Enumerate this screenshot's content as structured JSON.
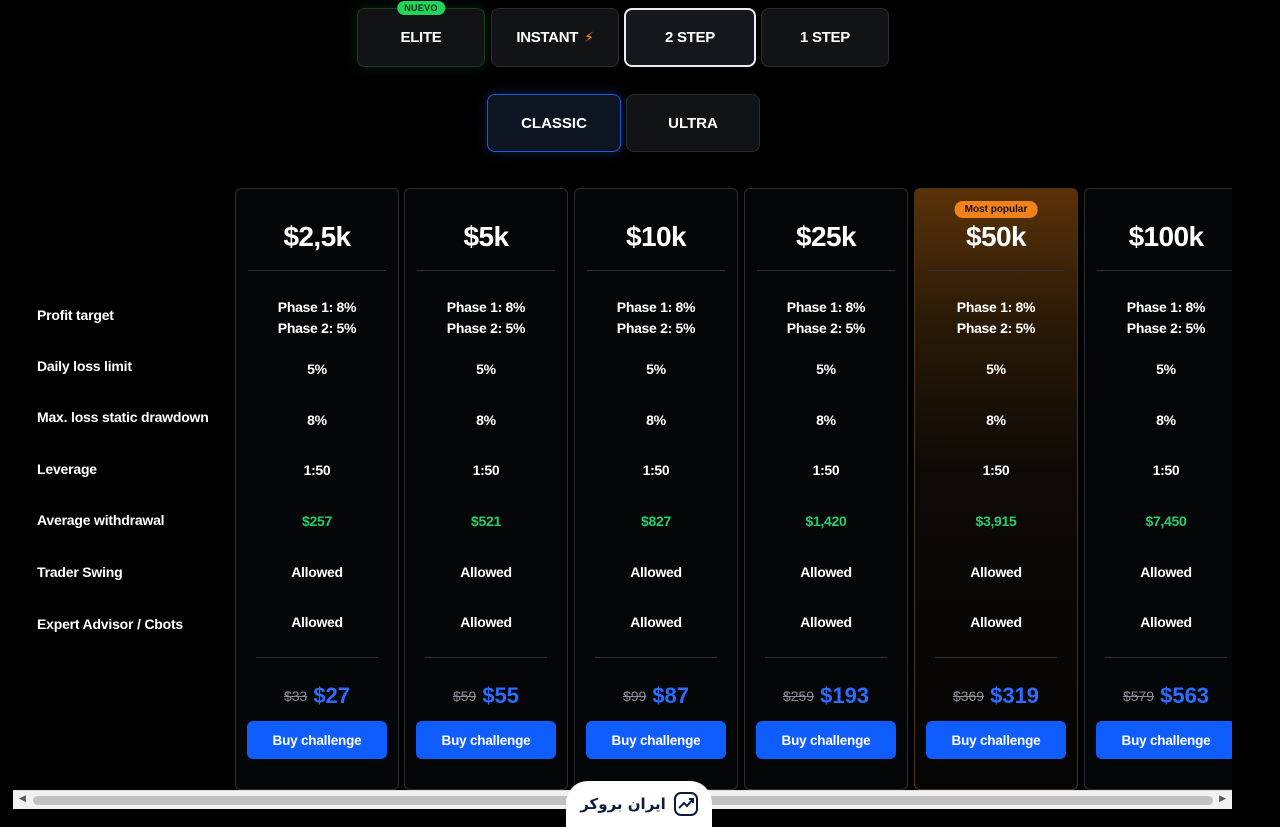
{
  "program_tabs": [
    {
      "label": "ELITE",
      "badge": "NUEVO"
    },
    {
      "label": "INSTANT",
      "icon": "lightning-bolt-icon"
    },
    {
      "label": "2 STEP",
      "active": true
    },
    {
      "label": "1 STEP"
    }
  ],
  "sub_tabs": [
    {
      "label": "CLASSIC",
      "active": true
    },
    {
      "label": "ULTRA"
    }
  ],
  "row_labels": {
    "profit_target": "Profit target",
    "daily_loss": "Daily loss limit",
    "max_loss": "Max.  loss static drawdown",
    "leverage": "Leverage",
    "avg_withdrawal": "Average withdrawal",
    "trader_swing": "Trader Swing",
    "expert_advisor": "Expert Advisor / Cbots"
  },
  "popular_badge": "Most popular",
  "buy_label": "Buy challenge",
  "plans": [
    {
      "size": "$2,5k",
      "phase1": "Phase 1: 8%",
      "phase2": "Phase 2: 5%",
      "daily_loss": "5%",
      "max_loss": "8%",
      "leverage": "1:50",
      "avg_withdrawal": "$257",
      "trader_swing": "Allowed",
      "expert_advisor": "Allowed",
      "old_price": "$33",
      "price": "$27"
    },
    {
      "size": "$5k",
      "phase1": "Phase 1: 8%",
      "phase2": "Phase 2: 5%",
      "daily_loss": "5%",
      "max_loss": "8%",
      "leverage": "1:50",
      "avg_withdrawal": "$521",
      "trader_swing": "Allowed",
      "expert_advisor": "Allowed",
      "old_price": "$59",
      "price": "$55"
    },
    {
      "size": "$10k",
      "phase1": "Phase 1: 8%",
      "phase2": "Phase 2: 5%",
      "daily_loss": "5%",
      "max_loss": "8%",
      "leverage": "1:50",
      "avg_withdrawal": "$827",
      "trader_swing": "Allowed",
      "expert_advisor": "Allowed",
      "old_price": "$99",
      "price": "$87"
    },
    {
      "size": "$25k",
      "phase1": "Phase 1: 8%",
      "phase2": "Phase 2: 5%",
      "daily_loss": "5%",
      "max_loss": "8%",
      "leverage": "1:50",
      "avg_withdrawal": "$1,420",
      "trader_swing": "Allowed",
      "expert_advisor": "Allowed",
      "old_price": "$259",
      "price": "$193"
    },
    {
      "size": "$50k",
      "popular": true,
      "phase1": "Phase 1: 8%",
      "phase2": "Phase 2: 5%",
      "daily_loss": "5%",
      "max_loss": "8%",
      "leverage": "1:50",
      "avg_withdrawal": "$3,915",
      "trader_swing": "Allowed",
      "expert_advisor": "Allowed",
      "old_price": "$369",
      "price": "$319"
    },
    {
      "size": "$100k",
      "phase1": "Phase 1: 8%",
      "phase2": "Phase 2: 5%",
      "daily_loss": "5%",
      "max_loss": "8%",
      "leverage": "1:50",
      "avg_withdrawal": "$7,450",
      "trader_swing": "Allowed",
      "expert_advisor": "Allowed",
      "old_price": "$579",
      "price": "$563"
    }
  ],
  "watermark": {
    "text": "ایران بروکر",
    "icon": "trend-chart-icon"
  },
  "colors": {
    "accent_blue": "#0f5cff",
    "price_blue": "#2b6dff",
    "withdrawal_green": "#24d06a",
    "popular_orange": "#f0821c",
    "badge_green": "#22d35c"
  }
}
